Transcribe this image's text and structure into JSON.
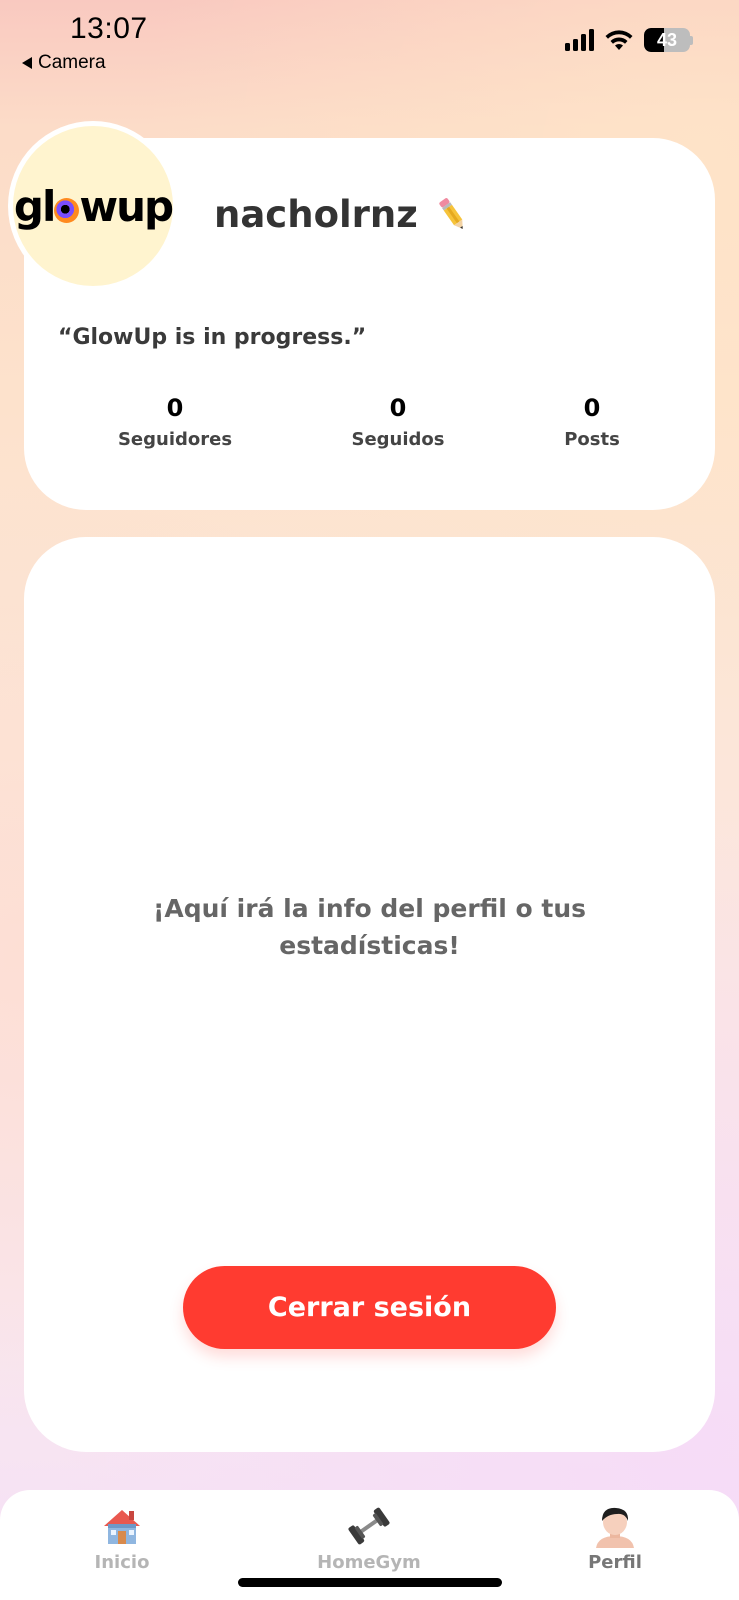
{
  "status_bar": {
    "time": "13:07",
    "back_label": "Camera",
    "battery": "43",
    "battery_level": 0.43,
    "icons": [
      "back-arrow-icon",
      "cellular-signal-icon",
      "wifi-icon",
      "battery-icon"
    ]
  },
  "profile": {
    "avatar_logo_text_before": "gl",
    "avatar_logo_text_after": "wup",
    "username": "nacholrnz",
    "edit_icon": "pencil-icon",
    "bio": "“GlowUp is in progress.”",
    "stats": [
      {
        "value": "0",
        "label": "Seguidores"
      },
      {
        "value": "0",
        "label": "Seguidos"
      },
      {
        "value": "0",
        "label": "Posts"
      }
    ]
  },
  "main": {
    "placeholder_line1": "¡Aquí irá la info del perfil o tus",
    "placeholder_line2": "estadísticas!",
    "logout_label": "Cerrar sesión"
  },
  "tabs": [
    {
      "label": "Inicio",
      "icon": "house-icon",
      "active": false
    },
    {
      "label": "HomeGym",
      "icon": "dumbbell-icon",
      "active": false
    },
    {
      "label": "Perfil",
      "icon": "person-icon",
      "active": true
    }
  ],
  "colors": {
    "accent": "#ff3b30",
    "card": "#ffffff",
    "avatar_bg": "#fff4cf"
  }
}
